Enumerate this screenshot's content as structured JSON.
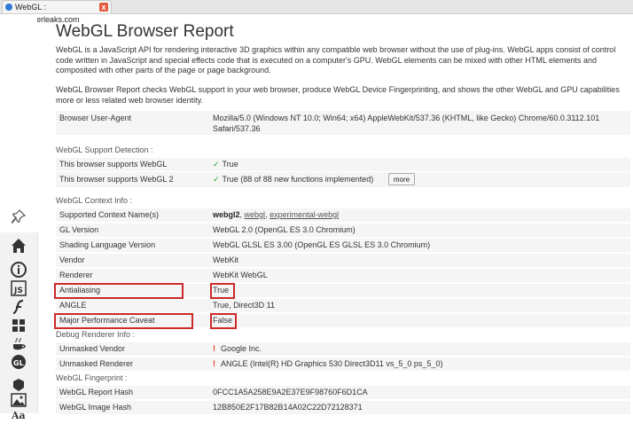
{
  "browser_tab": {
    "title": "WebGL : browserleaks.com",
    "close_label": "x"
  },
  "page": {
    "title": "WebGL Browser Report",
    "intro1": "WebGL is a JavaScript API for rendering interactive 3D graphics within any compatible web browser without the use of plug-ins. WebGL apps consist of control code written in JavaScript and special effects code that is executed on a computer's GPU. WebGL elements can be mixed with other HTML elements and composited with other parts of the page or page background.",
    "intro2": "WebGL Browser Report checks WebGL support in your web browser, produce WebGL Device Fingerprinting, and shows the other WebGL and GPU capabilities more or less related web browser identity."
  },
  "user_agent": {
    "label": "Browser User-Agent",
    "value": "Mozilla/5.0 (Windows NT 10.0; Win64; x64) AppleWebKit/537.36 (KHTML, like Gecko) Chrome/60.0.3112.101 Safari/537.36"
  },
  "support": {
    "heading": "WebGL Support Detection :",
    "rows": [
      {
        "label": "This browser supports WebGL",
        "value": "True"
      },
      {
        "label": "This browser supports WebGL 2",
        "value": "True (88 of 88 new functions implemented)"
      }
    ],
    "more_label": "more"
  },
  "context": {
    "heading": "WebGL Context Info :",
    "context_names_label": "Supported Context Name(s)",
    "context_names": [
      "webgl2",
      "webgl",
      "experimental-webgl"
    ],
    "rows": [
      {
        "label": "GL Version",
        "value": "WebGL 2.0 (OpenGL ES 3.0 Chromium)"
      },
      {
        "label": "Shading Language Version",
        "value": "WebGL GLSL ES 3.00 (OpenGL ES GLSL ES 3.0 Chromium)"
      },
      {
        "label": "Vendor",
        "value": "WebKit"
      },
      {
        "label": "Renderer",
        "value": "WebKit WebGL"
      },
      {
        "label": "Antialiasing",
        "value": "True"
      },
      {
        "label": "ANGLE",
        "value": "True, Direct3D 11"
      },
      {
        "label": "Major Performance Caveat",
        "value": "False"
      }
    ]
  },
  "debug": {
    "heading": "Debug Renderer Info :",
    "rows": [
      {
        "label": "Unmasked Vendor",
        "value": "Google Inc."
      },
      {
        "label": "Unmasked Renderer",
        "value": "ANGLE (Intel(R) HD Graphics 530 Direct3D11 vs_5_0 ps_5_0)"
      }
    ]
  },
  "fingerprint": {
    "heading": "WebGL Fingerprint :",
    "rows": [
      {
        "label": "WebGL Report Hash",
        "value": "0FCC1A5A258E9A2E37E9F98760F6D1CA"
      },
      {
        "label": "WebGL Image Hash",
        "value": "12B850E2F17B82B14A02C22D72128371"
      }
    ]
  },
  "colors": {
    "check": "#2e9e3a",
    "warning": "#e0301e",
    "highlight": "#cc2a2a",
    "row_bg": "#f5f5f5"
  },
  "sidebar_icons": [
    "pin-icon",
    "home-icon",
    "info-icon",
    "javascript-icon",
    "flash-icon",
    "windows-icon",
    "java-icon",
    "webgl-icon",
    "html5-icon",
    "image-icon",
    "font-icon"
  ]
}
